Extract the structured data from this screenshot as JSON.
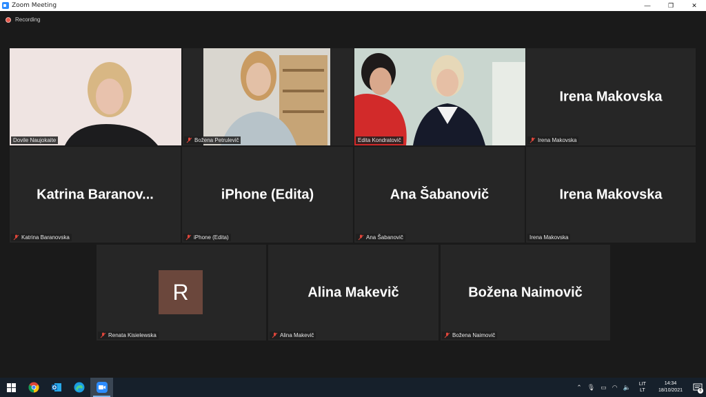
{
  "window": {
    "title": "Zoom Meeting",
    "minimize_glyph": "—",
    "maximize_glyph": "❐",
    "close_glyph": "✕"
  },
  "recording": {
    "label": "Recording"
  },
  "participants": [
    {
      "name": "Dovile Naujokaite",
      "display": "",
      "video": true,
      "muted": false,
      "active_speaker": true
    },
    {
      "name": "Božena Petrulevič",
      "display": "",
      "video": true,
      "muted": true,
      "active_speaker": false
    },
    {
      "name": "Edita Kondratovič",
      "display": "",
      "video": true,
      "muted": false,
      "active_speaker": false
    },
    {
      "name": "Irena Makovska",
      "display": "Irena Makovska",
      "video": false,
      "muted": true,
      "active_speaker": false
    },
    {
      "name": "Katrina Baranovska",
      "display": "Katrina  Baranov...",
      "video": false,
      "muted": true,
      "active_speaker": false
    },
    {
      "name": "iPhone (Edita)",
      "display": "iPhone (Edita)",
      "video": false,
      "muted": true,
      "active_speaker": false
    },
    {
      "name": "Ana Šabanovič",
      "display": "Ana Šabanovič",
      "video": false,
      "muted": true,
      "active_speaker": false
    },
    {
      "name": "Irena Makovska",
      "display": "Irena Makovska",
      "video": false,
      "muted": false,
      "active_speaker": false
    },
    {
      "name": "Renata Kisielewska",
      "display": "R",
      "video": false,
      "muted": true,
      "active_speaker": false,
      "avatar": true
    },
    {
      "name": "Alina Makevič",
      "display": "Alina Makevič",
      "video": false,
      "muted": true,
      "active_speaker": false
    },
    {
      "name": "Božena Naimovič",
      "display": "Božena Naimovič",
      "video": false,
      "muted": true,
      "active_speaker": false
    }
  ],
  "taskbar": {
    "apps": [
      "windows-start",
      "chrome",
      "outlook",
      "edge",
      "zoom"
    ],
    "tray": {
      "language_top": "LIT",
      "language_bottom": "LT",
      "time": "14:34",
      "date": "18/10/2021",
      "notification_count": "6"
    }
  },
  "colors": {
    "active_speaker_border": "#c9e05a",
    "tile_bg": "#262626",
    "mute_red": "#e0463a",
    "avatar_bg": "#6b473c"
  }
}
